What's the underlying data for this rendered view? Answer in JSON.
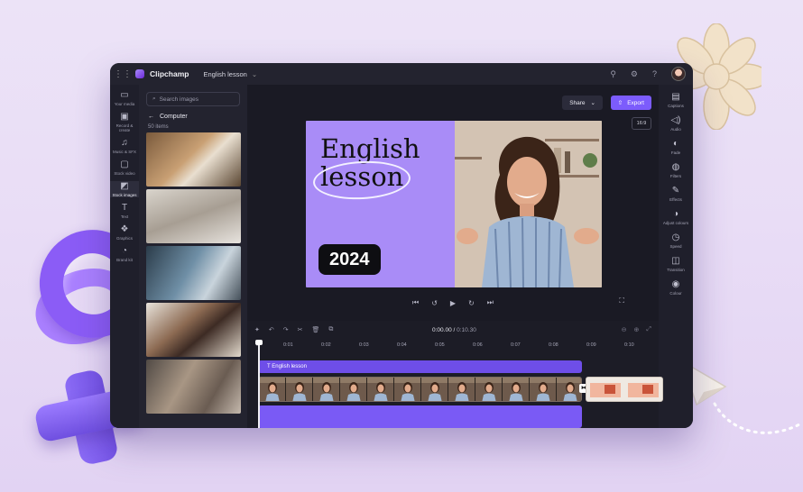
{
  "app": {
    "name": "Clipchamp",
    "project_name": "English lesson"
  },
  "left_rail": [
    {
      "label": "Your media",
      "icon": "folder-icon"
    },
    {
      "label": "Record & create",
      "icon": "camera-icon"
    },
    {
      "label": "Music & SFX",
      "icon": "music-icon"
    },
    {
      "label": "Stock video",
      "icon": "film-icon"
    },
    {
      "label": "Stock images",
      "icon": "image-icon"
    },
    {
      "label": "Text",
      "icon": "text-icon"
    },
    {
      "label": "Graphics",
      "icon": "shapes-icon"
    },
    {
      "label": "Brand kit",
      "icon": "brand-icon"
    }
  ],
  "media_panel": {
    "search_placeholder": "Search images",
    "breadcrumb": "Computer",
    "count": "50 items"
  },
  "header_buttons": {
    "share": "Share",
    "export": "Export",
    "aspect_ratio": "16:9"
  },
  "canvas": {
    "title_line1": "English",
    "title_line2": "lesson",
    "year": "2024"
  },
  "right_rail": [
    {
      "label": "Captions",
      "icon": "captions-icon"
    },
    {
      "label": "Audio",
      "icon": "speaker-icon"
    },
    {
      "label": "Fade",
      "icon": "fade-icon"
    },
    {
      "label": "Filters",
      "icon": "filters-icon"
    },
    {
      "label": "Effects",
      "icon": "magic-wand-icon"
    },
    {
      "label": "Adjust colours",
      "icon": "adjust-icon"
    },
    {
      "label": "Speed",
      "icon": "speed-icon"
    },
    {
      "label": "Transition",
      "icon": "transition-icon"
    },
    {
      "label": "Colour",
      "icon": "palette-icon"
    }
  ],
  "timeline": {
    "current_time": "0:00.00",
    "total_time": "0:10.30",
    "ruler": [
      "0:01",
      "0:02",
      "0:03",
      "0:04",
      "0:05",
      "0:06",
      "0:07",
      "0:08",
      "0:09",
      "0:10"
    ],
    "text_track_label": "English lesson"
  }
}
